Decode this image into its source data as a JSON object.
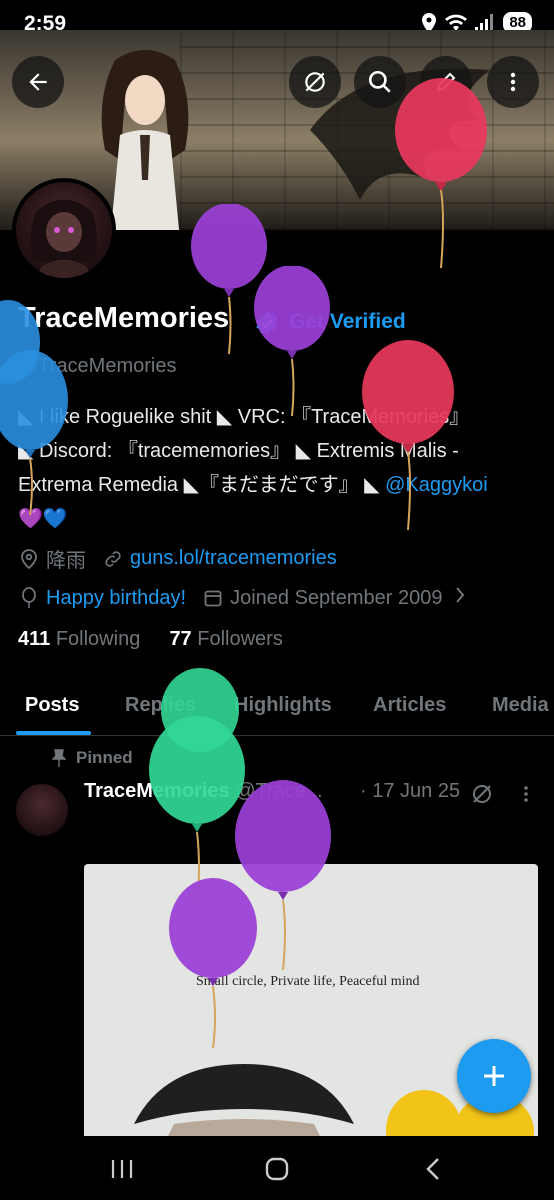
{
  "status_bar": {
    "time": "2:59",
    "battery": "88"
  },
  "profile": {
    "name": "TraceMemories",
    "get_verified": "Get Verified",
    "handle": "@TraceMemories",
    "bio_line1": "◣ I like Roguelike shit ◣ VRC: 『TraceMemories』",
    "bio_line2": "◣ Discord: 『tracememories』 ◣ Extremis Malis -",
    "bio_line3_text": "Extrema Remedia ◣『まだまだです』 ◣ ",
    "bio_mention": "@Kaggykoi",
    "bio_line4": "💜💙",
    "location": "降雨",
    "website": "guns.lol/tracememories",
    "birthday": "Happy birthday!",
    "joined": "Joined September 2009",
    "following_count": "411",
    "following_label": "Following",
    "followers_count": "77",
    "followers_label": "Followers"
  },
  "tabs": [
    "Posts",
    "Replies",
    "Highlights",
    "Articles",
    "Media"
  ],
  "post": {
    "pinned_label": "Pinned",
    "author": "TraceMemories",
    "handle": "@Trace...",
    "date": "· 17 Jun 25",
    "image_text": "Small circle, Private life, Peaceful mind"
  },
  "colors": {
    "accent": "#1d9bf0",
    "balloon_red": "#e8385d",
    "balloon_purple": "#9b3fd6",
    "balloon_green": "#32d896",
    "balloon_blue": "#2a8fe0",
    "balloon_yellow": "#f2c418"
  }
}
